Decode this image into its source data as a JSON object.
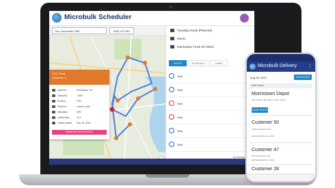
{
  "app": {
    "title": "Microbulk Scheduler",
    "date_value": "Thu, December 19th",
    "end_day_label": "END OF DAY"
  },
  "truck_card": {
    "title": "T10 | Truck",
    "subtitle": "Customer #",
    "rows": [
      {
        "label": "Address",
        "value": "Morristown, NJ"
      },
      {
        "label": "Capacity",
        "value": "1,500"
      },
      {
        "label": "Product",
        "value": "OXY"
      },
      {
        "label": "Planned",
        "value": "current route"
      },
      {
        "label": "Utilization",
        "value": "45%"
      },
      {
        "label": "Latest stop",
        "value": "4:11"
      },
      {
        "label": "Latest update",
        "value": "Dec 19, 2019"
      }
    ],
    "remove_label": "REMOVE FROM ROUTE"
  },
  "right_panel": {
    "row1": "Tuesday Route (Planned)",
    "row2": "Morris",
    "row3": "Morristown Truck 02 #2021",
    "tabs": [
      "ROUTE",
      "SCHEDULE",
      "CHART"
    ],
    "stops": [
      "Stop",
      "Stop",
      "Stop",
      "Stop",
      "Stop",
      "Stop",
      "Stop"
    ],
    "map_label": "ES MANUEL 62",
    "colors": {
      "accent": "#1f86c7",
      "header": "#1e3a6e",
      "card": "#e07a2a",
      "button": "#e2457b"
    }
  },
  "phone": {
    "title": "Microbulk Delivery",
    "menu_icon": "more-vert-icon",
    "date": "Aug 28, 2019",
    "no_routes_label": "NO ROUTES",
    "section_label": "Start Depot",
    "depot": {
      "name": "Morristown Depot",
      "address": "40 Park Ave, Morristown, New Jersey",
      "button": "START ROUTE"
    },
    "customers": [
      {
        "name": "Customer 50",
        "address": "1000 Somewhere Rd",
        "delivery": "Estimated Delivery: 150 L"
      },
      {
        "name": "Customer 47",
        "address": "100 Somewhere Rd",
        "delivery": "Estimated Delivery: 100 L"
      },
      {
        "name": "Customer 28",
        "address": "",
        "delivery": ""
      }
    ]
  }
}
